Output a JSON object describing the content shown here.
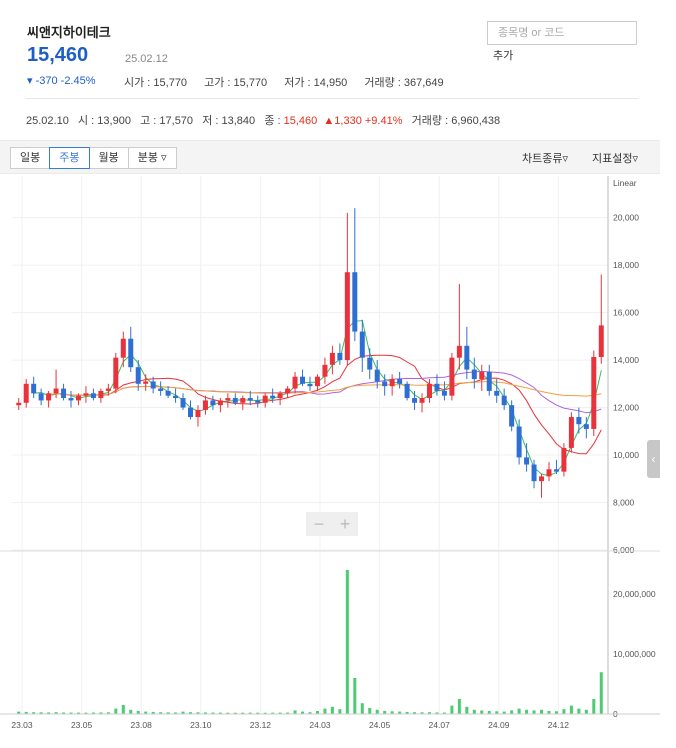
{
  "stock": {
    "name": "씨앤지하이테크",
    "price": "15,460",
    "date": "25.02.12",
    "change": "▾ -370 -2.45%",
    "open_label": "시가 : 15,770",
    "high_label": "고가 : 15,770",
    "low_label": "저가 : 14,950",
    "volume_label": "거래량 : 367,649"
  },
  "search": {
    "placeholder": "종목명 or 코드",
    "add_label": "추가"
  },
  "prev_day": {
    "date": "25.02.10",
    "open": "시 : 13,900",
    "high": "고 : 17,570",
    "low": "저 : 13,840",
    "close_label": "종 : ",
    "close_value": "15,460",
    "change": "▲1,330 +9.41%",
    "volume": "거래량 : 6,960,438"
  },
  "toolbar": {
    "tabs": [
      "일봉",
      "주봉",
      "월봉",
      "분봉 ▿"
    ],
    "active_tab": "주봉",
    "chart_type": "차트종류▿",
    "indicator": "지표설정▿"
  },
  "colors": {
    "up": "#e8323c",
    "down": "#2f6fd4",
    "ma5": "#35c15a",
    "ma20": "#e8323c",
    "ma60": "#b063e0",
    "ma120": "#f0a040",
    "volume": "#4ccb72"
  },
  "chart_data": {
    "type": "candlestick",
    "scale_label": "Linear",
    "x_ticks": [
      "23.03",
      "23.05",
      "23.08",
      "23.10",
      "23.12",
      "24.03",
      "24.05",
      "24.07",
      "24.09",
      "24.12"
    ],
    "price_ticks": [
      "20,000",
      "18,000",
      "16,000",
      "14,000",
      "12,000",
      "10,000",
      "8,000",
      "6,000"
    ],
    "price_tick_values": [
      20000,
      18000,
      16000,
      14000,
      12000,
      10000,
      8000,
      6000
    ],
    "volume_ticks": [
      "20,000,000",
      "10,000,000",
      "0"
    ],
    "volume_tick_values": [
      20000000,
      10000000,
      0
    ],
    "ylim_price": [
      6000,
      21500
    ],
    "ylim_volume": [
      0,
      26000000
    ],
    "candles": [
      [
        12100,
        12400,
        11900,
        12200
      ],
      [
        12200,
        13200,
        12000,
        13000
      ],
      [
        13000,
        13300,
        12400,
        12600
      ],
      [
        12600,
        12800,
        12100,
        12300
      ],
      [
        12300,
        12700,
        12000,
        12600
      ],
      [
        12600,
        13600,
        12400,
        12800
      ],
      [
        12800,
        13000,
        12300,
        12400
      ],
      [
        12400,
        12700,
        12000,
        12300
      ],
      [
        12300,
        12600,
        12100,
        12500
      ],
      [
        12500,
        12900,
        12200,
        12600
      ],
      [
        12600,
        12800,
        12300,
        12400
      ],
      [
        12400,
        12800,
        12200,
        12700
      ],
      [
        12700,
        13000,
        12500,
        12800
      ],
      [
        12800,
        14300,
        12600,
        14100
      ],
      [
        14100,
        15200,
        13700,
        14900
      ],
      [
        14900,
        15400,
        13500,
        13700
      ],
      [
        13700,
        14000,
        12700,
        13000
      ],
      [
        13000,
        13400,
        12700,
        13100
      ],
      [
        13100,
        13300,
        12600,
        12800
      ],
      [
        12800,
        13100,
        12500,
        12700
      ],
      [
        12700,
        12900,
        12400,
        12500
      ],
      [
        12500,
        12800,
        12200,
        12400
      ],
      [
        12400,
        12600,
        11900,
        12000
      ],
      [
        12000,
        12300,
        11500,
        11600
      ],
      [
        11600,
        12100,
        11200,
        11900
      ],
      [
        11900,
        12500,
        11700,
        12300
      ],
      [
        12300,
        12500,
        11900,
        12100
      ],
      [
        12100,
        12400,
        11800,
        12300
      ],
      [
        12300,
        12600,
        12000,
        12400
      ],
      [
        12400,
        12600,
        12100,
        12200
      ],
      [
        12200,
        12500,
        11900,
        12400
      ],
      [
        12400,
        12700,
        12100,
        12300
      ],
      [
        12300,
        12500,
        12000,
        12200
      ],
      [
        12200,
        12600,
        12000,
        12500
      ],
      [
        12500,
        12800,
        12200,
        12400
      ],
      [
        12400,
        12700,
        12100,
        12600
      ],
      [
        12600,
        12900,
        12400,
        12800
      ],
      [
        12800,
        13500,
        12600,
        13300
      ],
      [
        13300,
        13600,
        12900,
        13000
      ],
      [
        13000,
        13300,
        12700,
        12900
      ],
      [
        12900,
        13400,
        12700,
        13300
      ],
      [
        13300,
        14100,
        13000,
        13800
      ],
      [
        13800,
        14600,
        13400,
        14300
      ],
      [
        14300,
        14700,
        13800,
        14000
      ],
      [
        14000,
        20200,
        13800,
        17700
      ],
      [
        17700,
        20400,
        14800,
        15200
      ],
      [
        15200,
        15700,
        13500,
        14100
      ],
      [
        14100,
        14500,
        13200,
        13600
      ],
      [
        13600,
        14000,
        12800,
        13100
      ],
      [
        13100,
        13400,
        12500,
        12900
      ],
      [
        12900,
        13400,
        12500,
        13200
      ],
      [
        13200,
        13500,
        12800,
        13000
      ],
      [
        13000,
        13100,
        12300,
        12400
      ],
      [
        12400,
        12700,
        11900,
        12200
      ],
      [
        12200,
        12600,
        11800,
        12400
      ],
      [
        12400,
        13200,
        12200,
        13000
      ],
      [
        13000,
        13400,
        12500,
        12700
      ],
      [
        12700,
        13100,
        12300,
        12500
      ],
      [
        12500,
        14300,
        12300,
        14100
      ],
      [
        14100,
        17200,
        13600,
        14600
      ],
      [
        14600,
        15400,
        13200,
        13600
      ],
      [
        13600,
        14100,
        12800,
        13200
      ],
      [
        13200,
        13800,
        12700,
        13500
      ],
      [
        13500,
        13800,
        12500,
        12700
      ],
      [
        12700,
        13200,
        12200,
        12500
      ],
      [
        12500,
        12800,
        11900,
        12100
      ],
      [
        12100,
        12300,
        11000,
        11200
      ],
      [
        11200,
        11500,
        9600,
        9900
      ],
      [
        9900,
        10500,
        9300,
        9600
      ],
      [
        9600,
        9800,
        8600,
        8900
      ],
      [
        8900,
        9200,
        8200,
        9100
      ],
      [
        9100,
        9700,
        8900,
        9400
      ],
      [
        9400,
        9800,
        9200,
        9300
      ],
      [
        9300,
        10500,
        9100,
        10300
      ],
      [
        10300,
        11800,
        10100,
        11600
      ],
      [
        11600,
        12000,
        10900,
        11300
      ],
      [
        11300,
        11600,
        10700,
        11100
      ],
      [
        11100,
        14400,
        10800,
        14130
      ],
      [
        14130,
        17600,
        13840,
        15460
      ]
    ],
    "volumes": [
      400000,
      350000,
      300000,
      280000,
      260000,
      300000,
      250000,
      240000,
      230000,
      220000,
      240000,
      260000,
      280000,
      900000,
      1500000,
      700000,
      500000,
      400000,
      350000,
      300000,
      280000,
      260000,
      400000,
      300000,
      280000,
      260000,
      240000,
      230000,
      220000,
      210000,
      220000,
      230000,
      220000,
      210000,
      220000,
      230000,
      240000,
      600000,
      400000,
      300000,
      500000,
      900000,
      1200000,
      800000,
      24000000,
      6000000,
      1800000,
      1000000,
      700000,
      500000,
      450000,
      400000,
      350000,
      300000,
      280000,
      300000,
      260000,
      240000,
      1400000,
      2500000,
      1200000,
      700000,
      600000,
      500000,
      450000,
      400000,
      600000,
      900000,
      700000,
      600000,
      700000,
      500000,
      450000,
      800000,
      1400000,
      900000,
      700000,
      2500000,
      6960438
    ]
  }
}
